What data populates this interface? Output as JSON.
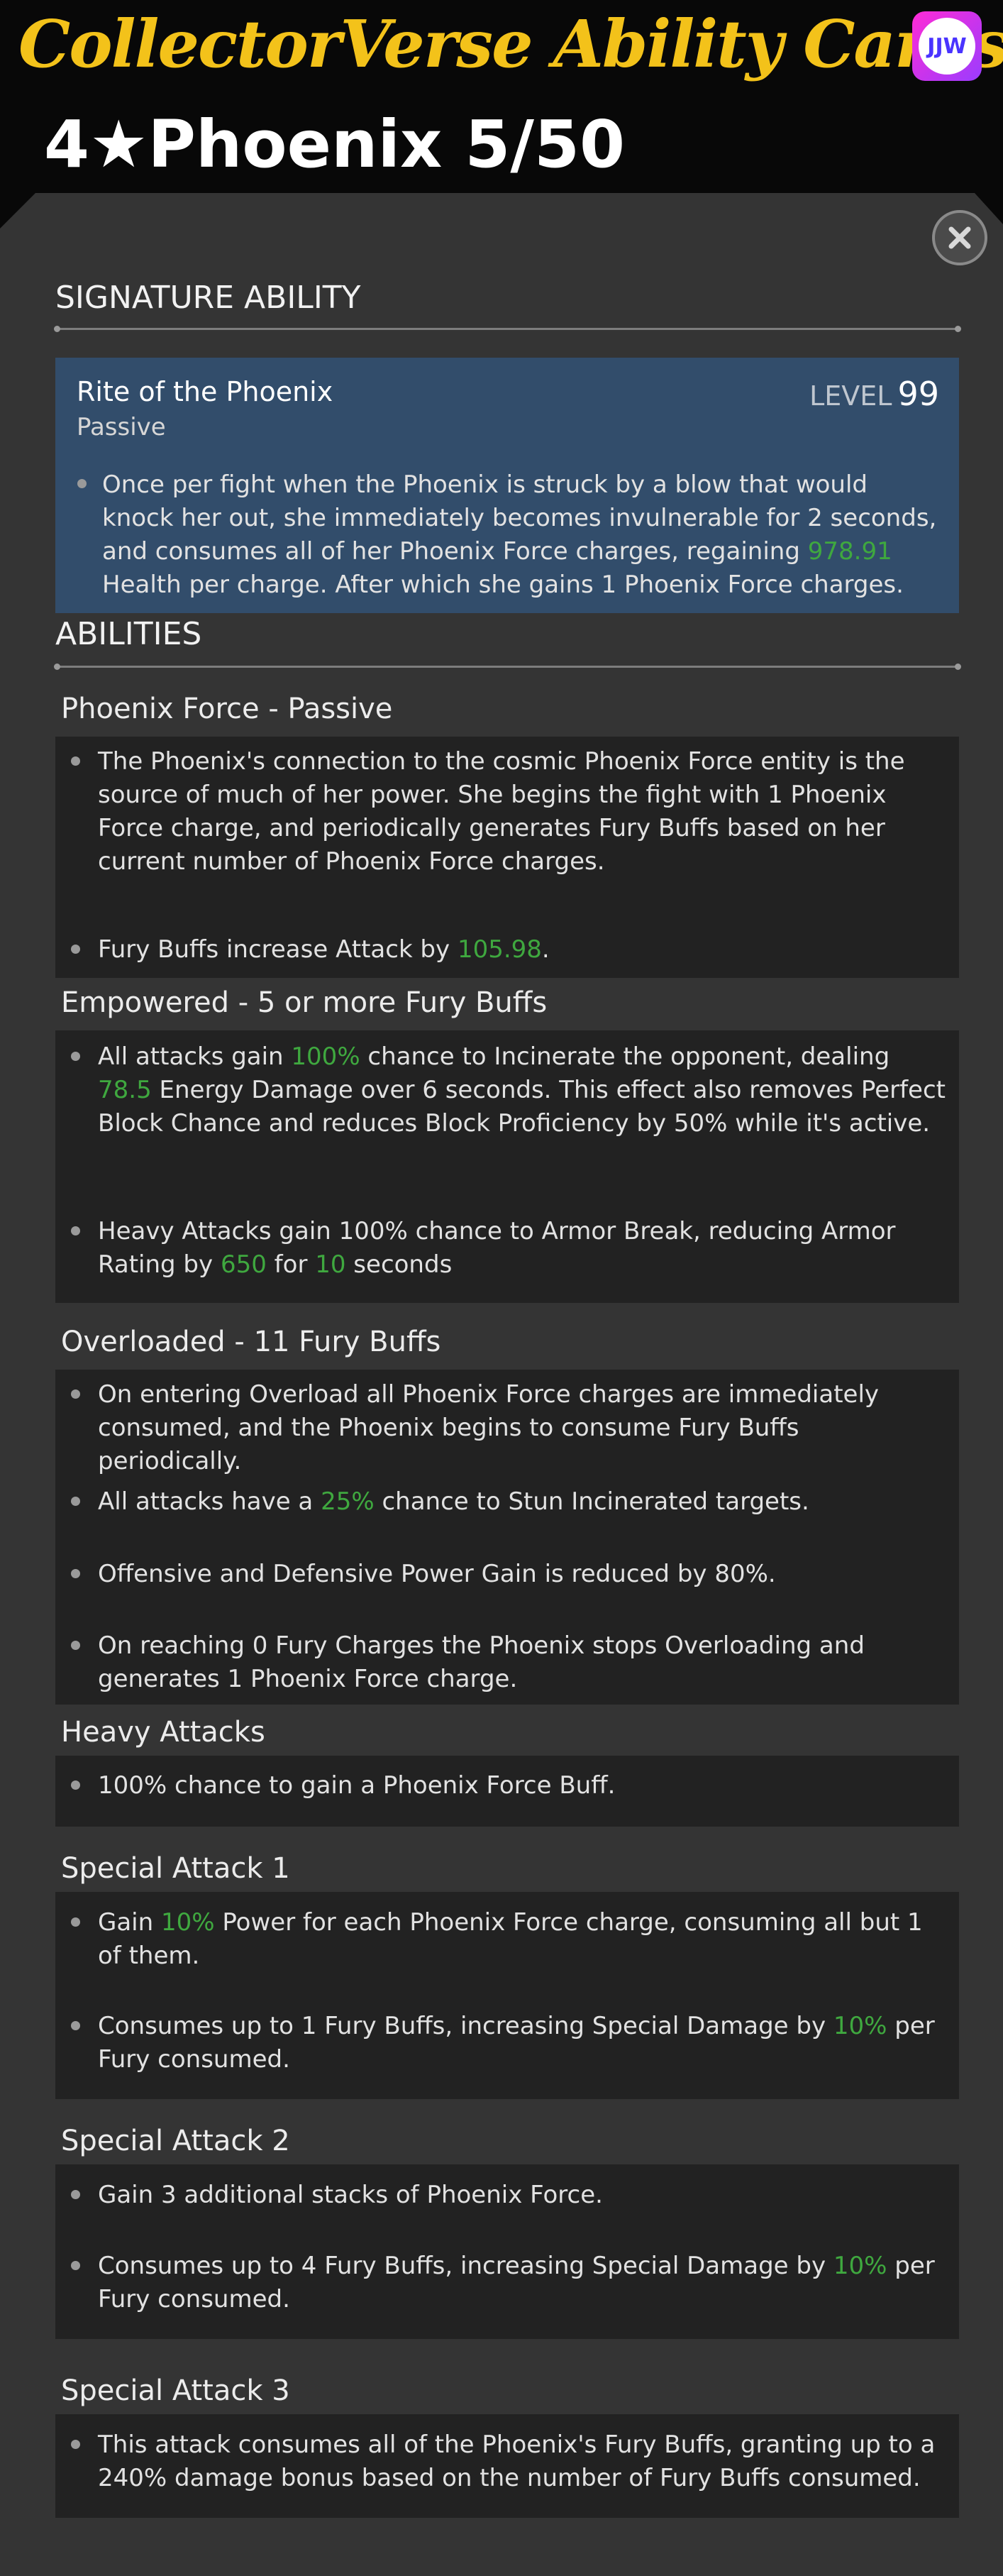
{
  "header": {
    "title": "CollectorVerse Ability Cards",
    "logo_text": "JJW",
    "champion": "4★Phoenix 5/50"
  },
  "close_icon": "close-icon",
  "signature": {
    "heading": "SIGNATURE ABILITY",
    "name": "Rite of the Phoenix",
    "type": "Passive",
    "level_label": "LEVEL",
    "level_value": "99",
    "bullets": [
      [
        "Once per fight when the Phoenix is struck by a blow that would knock her out, she immediately becomes invulnerable for 2 seconds, and consumes all of her Phoenix Force charges, regaining ",
        {
          "g": "978.91"
        },
        " Health per charge. After which she gains 1 Phoenix Force charges."
      ]
    ]
  },
  "abilities_heading": "ABILITIES",
  "sections": [
    {
      "title": "Phoenix Force - Passive",
      "bullets": [
        [
          "The Phoenix's connection to the cosmic Phoenix Force entity is the source of much of her power. She begins the fight with 1 Phoenix Force charge, and periodically generates Fury Buffs based on her current number of Phoenix Force charges."
        ],
        [
          "Fury Buffs increase Attack by ",
          {
            "g": "105.98"
          },
          "."
        ]
      ]
    },
    {
      "title": "Empowered - 5 or more Fury Buffs",
      "bullets": [
        [
          "All attacks gain ",
          {
            "g": "100%"
          },
          " chance to Incinerate the opponent, dealing ",
          {
            "g": "78.5"
          },
          " Energy Damage over 6 seconds. This effect also removes Perfect Block Chance and reduces Block Proficiency by 50% while it's active."
        ],
        [
          "Heavy Attacks gain 100% chance to Armor Break, reducing Armor Rating by ",
          {
            "g": "650"
          },
          " for ",
          {
            "g": "10"
          },
          " seconds"
        ]
      ]
    },
    {
      "title": "Overloaded - 11 Fury Buffs",
      "bullets": [
        [
          "On entering Overload all Phoenix Force charges are immediately consumed, and the Phoenix begins to consume Fury Buffs periodically."
        ],
        [
          "All attacks have a ",
          {
            "g": "25%"
          },
          " chance to Stun Incinerated targets."
        ],
        [
          "Offensive and Defensive Power Gain is reduced by 80%."
        ],
        [
          "On reaching 0 Fury Charges the Phoenix stops Overloading and generates 1 Phoenix Force charge."
        ]
      ]
    },
    {
      "title": "Heavy Attacks",
      "bullets": [
        [
          "100% chance to gain a Phoenix Force Buff."
        ]
      ]
    },
    {
      "title": "Special Attack 1",
      "bullets": [
        [
          "Gain ",
          {
            "g": "10%"
          },
          " Power for each Phoenix Force charge, consuming all but 1 of them."
        ],
        [
          "Consumes up to 1 Fury Buffs, increasing Special Damage by ",
          {
            "g": "10%"
          },
          " per Fury consumed."
        ]
      ]
    },
    {
      "title": "Special Attack 2",
      "bullets": [
        [
          "Gain 3 additional stacks of Phoenix Force."
        ],
        [
          "Consumes up to 4 Fury Buffs, increasing Special Damage by ",
          {
            "g": "10%"
          },
          " per Fury consumed."
        ]
      ]
    },
    {
      "title": "Special Attack 3",
      "bullets": [
        [
          "This attack consumes all of the Phoenix's Fury Buffs, granting up to a 240% damage bonus based on the number of Fury Buffs consumed."
        ]
      ]
    }
  ]
}
